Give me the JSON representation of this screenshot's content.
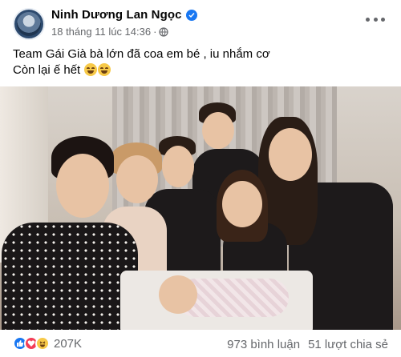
{
  "post": {
    "author": "Ninh Dương Lan Ngọc",
    "timestamp": "18 tháng 11 lúc 14:36",
    "separator": "·",
    "caption_line1": "Team Gái Già bà lớn đã coa em bé , iu nhắm cơ",
    "caption_line2": "Còn lại ế hết"
  },
  "icons": {
    "verified": "verified-badge-icon",
    "privacy": "globe-icon",
    "menu": "more-options-icon",
    "emoji": "rolling-on-floor-laughing-emoji"
  },
  "footer": {
    "reaction_count": "207K",
    "comments": "973 bình luận",
    "shares": "51 lượt chia sẻ",
    "reactions": [
      "like",
      "love",
      "haha"
    ]
  },
  "colors": {
    "brand_blue": "#1877f2",
    "secondary_text": "#65676b",
    "love_red": "#f33e58",
    "haha_yellow": "#f7c948"
  }
}
